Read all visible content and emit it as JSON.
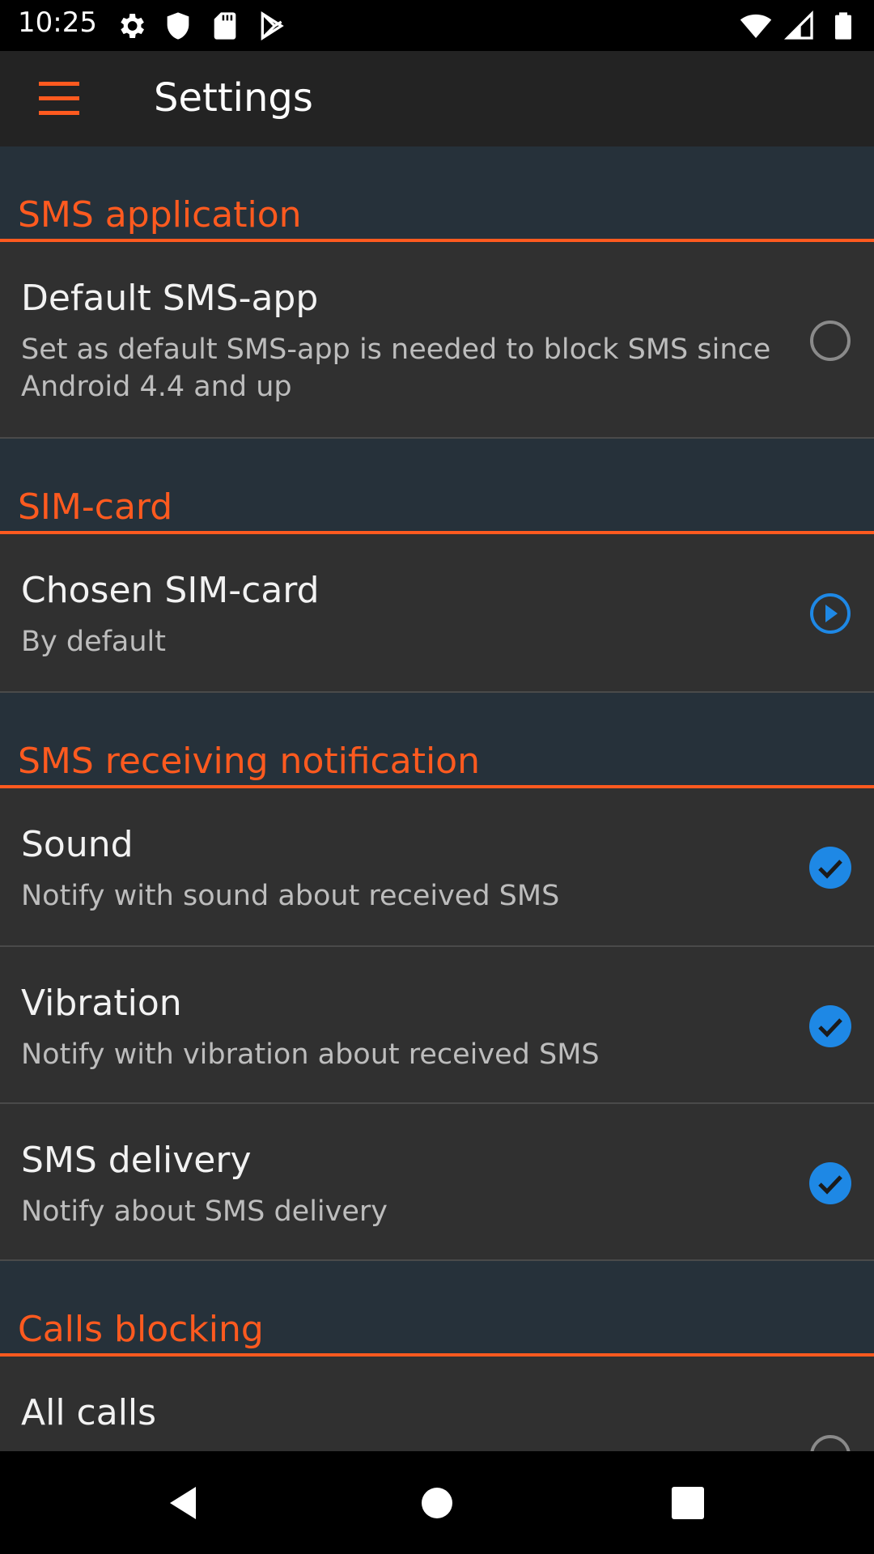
{
  "status_bar": {
    "time": "10:25",
    "left_icons": [
      "gear-icon",
      "shield-icon",
      "sd-card-icon",
      "play-store-icon"
    ],
    "right_icons": [
      "wifi-icon",
      "cell-signal-icon",
      "battery-icon"
    ]
  },
  "app_bar": {
    "title": "Settings",
    "menu_icon": "hamburger-menu-icon"
  },
  "colors": {
    "accent": "#ff5a1f",
    "checkbox": "#1e88e5",
    "background": "#26313a",
    "item_background": "#303030"
  },
  "sections": [
    {
      "title": "SMS application",
      "items": [
        {
          "title": "Default SMS-app",
          "summary": "Set as default SMS-app is needed to block SMS since Android 4.4 and up",
          "widget": "radio",
          "checked": false
        }
      ]
    },
    {
      "title": "SIM-card",
      "items": [
        {
          "title": "Chosen SIM-card",
          "summary": "By default",
          "widget": "play-circle-icon"
        }
      ]
    },
    {
      "title": "SMS receiving notification",
      "items": [
        {
          "title": "Sound",
          "summary": "Notify with sound about received SMS",
          "widget": "checkbox",
          "checked": true
        },
        {
          "title": "Vibration",
          "summary": "Notify with vibration about received SMS",
          "widget": "checkbox",
          "checked": true
        },
        {
          "title": "SMS delivery",
          "summary": "Notify about SMS delivery",
          "widget": "checkbox",
          "checked": true
        }
      ]
    },
    {
      "title": "Calls blocking",
      "items": [
        {
          "title": "All calls",
          "summary": "",
          "widget": "radio",
          "checked": false
        }
      ]
    }
  ],
  "nav_bar": {
    "buttons": [
      "back-icon",
      "home-icon",
      "recents-icon"
    ]
  }
}
